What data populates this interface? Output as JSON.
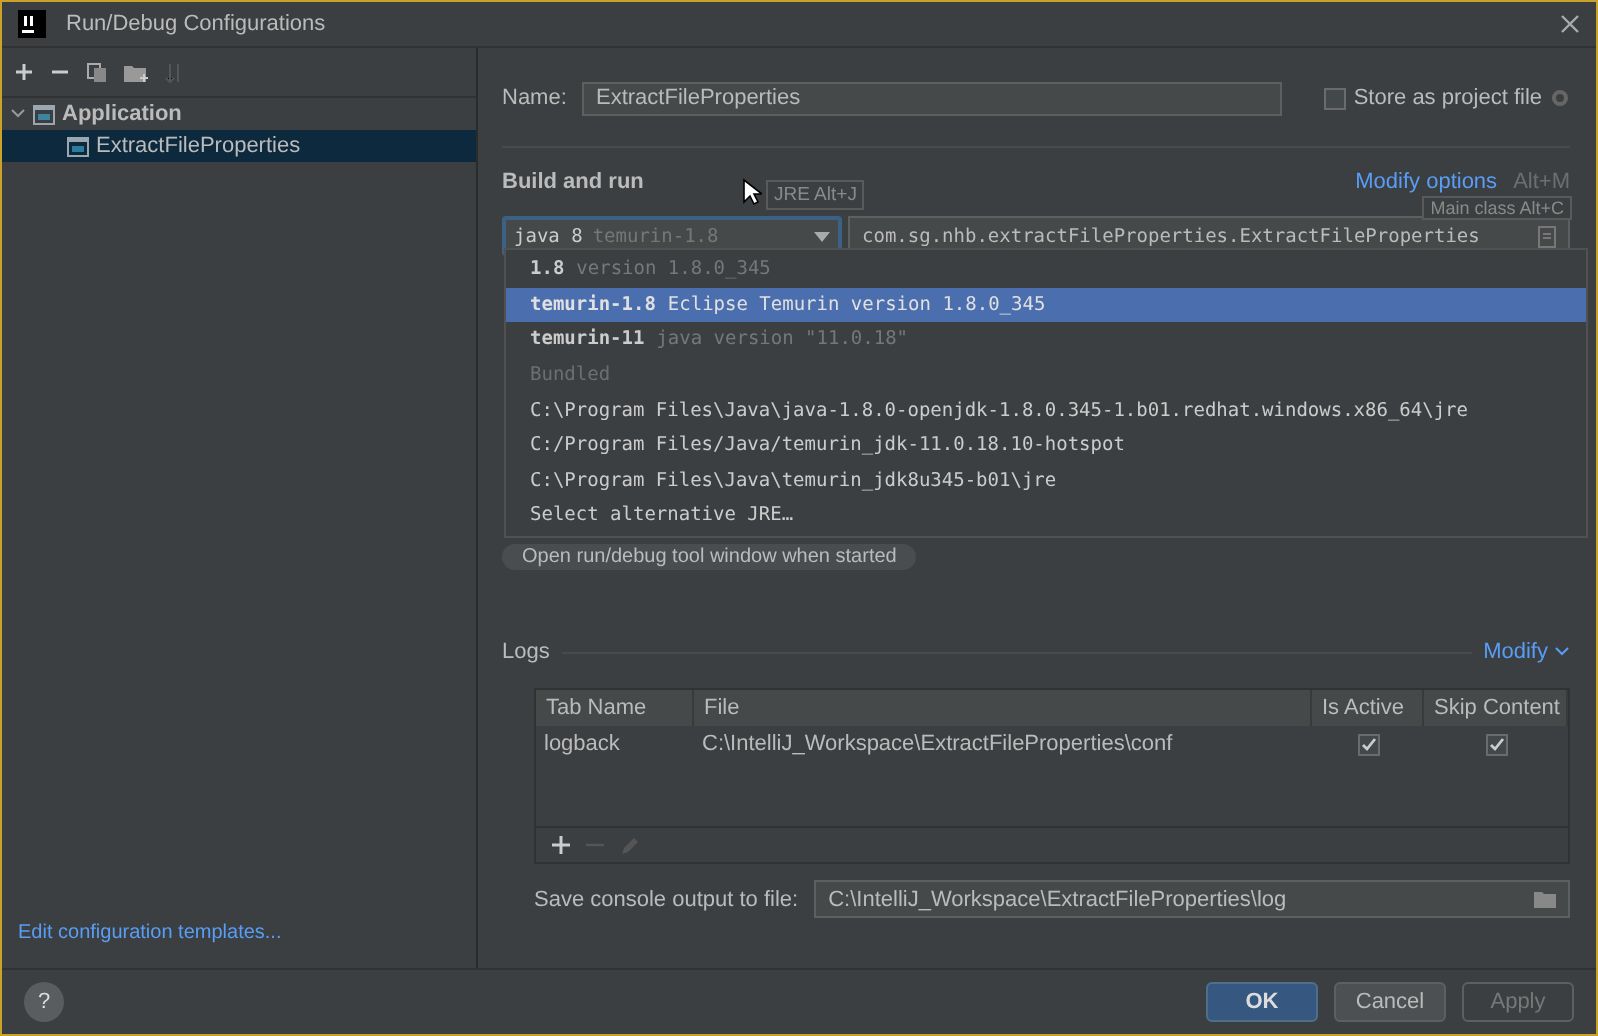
{
  "window": {
    "title": "Run/Debug Configurations"
  },
  "tree": [
    {
      "label": "Application",
      "expanded": true,
      "selected": false,
      "children": [
        {
          "label": "ExtractFileProperties",
          "selected": true
        }
      ]
    }
  ],
  "templates_link": "Edit configuration templates...",
  "name_field": {
    "label": "Name:",
    "value": "ExtractFileProperties"
  },
  "store_as_project": {
    "label": "Store as project file",
    "checked": false
  },
  "build_and_run": {
    "title": "Build and run",
    "modify_options": "Modify options",
    "shortcut": "Alt+M",
    "jre": {
      "value": "java 8",
      "hint": "temurin-1.8"
    },
    "main_class": {
      "value": "com.sg.nhb.extractFileProperties.ExtractFileProperties"
    },
    "option_chip": "Open run/debug tool window when started"
  },
  "tooltips": [
    {
      "text": "JRE Alt+J"
    },
    {
      "text": "Main class Alt+C"
    }
  ],
  "jre_popup": [
    {
      "kind": "item",
      "text": "1.8",
      "detail": "version 1.8.0_345",
      "selected": false
    },
    {
      "kind": "item",
      "text": "temurin-1.8",
      "detail": "Eclipse Temurin version 1.8.0_345",
      "selected": true
    },
    {
      "kind": "item",
      "text": "temurin-11",
      "detail": "java version \"11.0.18\"",
      "selected": false
    },
    {
      "kind": "header",
      "text": "Bundled"
    },
    {
      "kind": "item",
      "text": "C:\\Program Files\\Java\\java-1.8.0-openjdk-1.8.0.345-1.b01.redhat.windows.x86_64\\jre",
      "selected": false
    },
    {
      "kind": "item",
      "text": "C:/Program Files/Java/temurin_jdk-11.0.18.10-hotspot",
      "selected": false
    },
    {
      "kind": "item",
      "text": "C:\\Program Files\\Java\\temurin_jdk8u345-b01\\jre",
      "selected": false
    },
    {
      "kind": "item",
      "text": "Select alternative JRE…",
      "selected": false
    }
  ],
  "logs": {
    "title": "Logs",
    "modify": "Modify",
    "columns": [
      "Tab Name",
      "File",
      "Is Active",
      "Skip Content"
    ],
    "rows": [
      {
        "tab_name": "logback",
        "file": "C:\\IntelliJ_Workspace\\ExtractFileProperties\\conf",
        "is_active": true,
        "skip_content": true
      }
    ],
    "save_console": {
      "label": "Save console output to file:",
      "value": "C:\\IntelliJ_Workspace\\ExtractFileProperties\\log"
    }
  },
  "help": "?",
  "buttons": [
    {
      "label": "OK",
      "kind": "primary"
    },
    {
      "label": "Cancel",
      "kind": "normal"
    },
    {
      "label": "Apply",
      "kind": "disabled"
    }
  ]
}
